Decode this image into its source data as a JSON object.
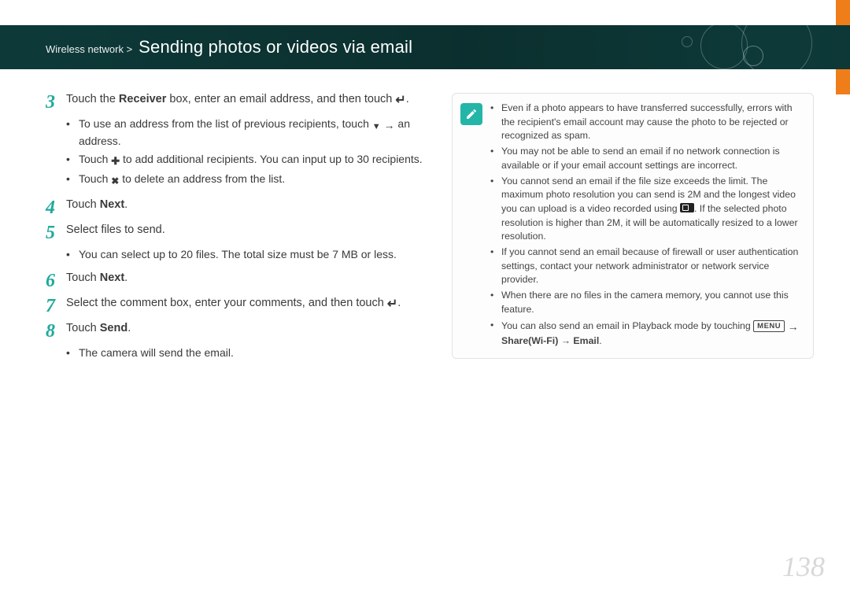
{
  "header": {
    "breadcrumb_prefix": "Wireless network >",
    "title": "Sending photos or videos via email"
  },
  "steps": {
    "s3": {
      "num": "3",
      "text_a": "Touch the ",
      "text_bold": "Receiver",
      "text_b": " box, enter an email address, and then touch ",
      "sub1_a": "To use an address from the list of previous recipients, touch ",
      "sub1_b": " an address.",
      "sub2_a": "Touch ",
      "sub2_b": " to add additional recipients. You can input up to 30 recipients.",
      "sub3_a": "Touch ",
      "sub3_b": " to delete an address from the list."
    },
    "s4": {
      "num": "4",
      "text_a": "Touch ",
      "text_bold": "Next",
      "text_b": "."
    },
    "s5": {
      "num": "5",
      "text": "Select files to send.",
      "sub1": "You can select up to 20 files. The total size must be 7 MB or less."
    },
    "s6": {
      "num": "6",
      "text_a": "Touch ",
      "text_bold": "Next",
      "text_b": "."
    },
    "s7": {
      "num": "7",
      "text": "Select the comment box, enter your comments, and then touch "
    },
    "s8": {
      "num": "8",
      "text_a": "Touch ",
      "text_bold": "Send",
      "text_b": ".",
      "sub1": "The camera will send the email."
    }
  },
  "note": {
    "n1": "Even if a photo appears to have transferred successfully, errors with the recipient's email account may cause the photo to be rejected or recognized as spam.",
    "n2": "You may not be able to send an email if no network connection is available or if your email account settings are incorrect.",
    "n3_a": "You cannot send an email if the file size exceeds the limit. The maximum photo resolution you can send is 2M and the longest video you can upload is a video recorded using ",
    "n3_b": ". If the selected photo resolution is higher than 2M, it will be automatically resized to a lower resolution.",
    "n4": "If you cannot send an email because of firewall or user authentication settings, contact your network administrator or network service provider.",
    "n5": "When there are no files in the camera memory, you cannot use this feature.",
    "n6_a": "You can also send an email in Playback mode by touching ",
    "n6_menu": "MENU",
    "n6_b_bold": "Share(Wi-Fi) → Email",
    "n6_c": "."
  },
  "page_number": "138"
}
